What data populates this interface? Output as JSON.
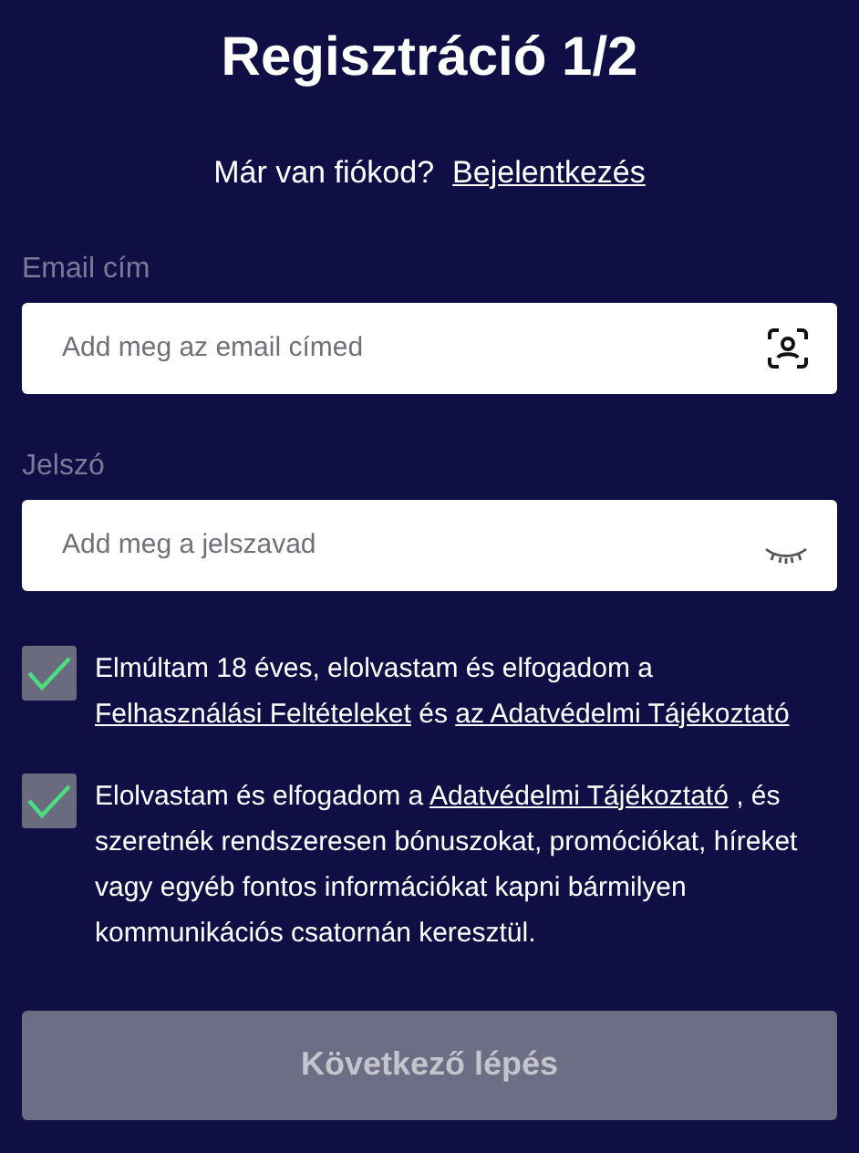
{
  "title": "Regisztráció 1/2",
  "login_prompt": {
    "text": "Már van fiókod?",
    "link": "Bejelentkezés"
  },
  "fields": [
    {
      "label": "Email cím",
      "placeholder": "Add meg az email címed",
      "kind": "email"
    },
    {
      "label": "Jelszó",
      "placeholder": "Add meg a jelszavad",
      "kind": "password"
    }
  ],
  "consents": [
    {
      "checked": true,
      "parts": [
        {
          "text": "Elmúltam 18 éves, elolvastam és elfogadom a ",
          "link": false
        },
        {
          "text": "Felhasználási Feltételeket",
          "link": true
        },
        {
          "text": " és ",
          "link": false
        },
        {
          "text": "az Adatvédelmi Tájékoztató",
          "link": true
        }
      ]
    },
    {
      "checked": true,
      "parts": [
        {
          "text": "Elolvastam és elfogadom a ",
          "link": false
        },
        {
          "text": "Adatvédelmi Tájékoztató",
          "link": true
        },
        {
          "text": " , és szeretnék rendszeresen bónuszokat, promóciókat, híreket vagy egyéb fontos információkat kapni bármilyen kommunikációs csatornán keresztül.",
          "link": false
        }
      ]
    }
  ],
  "next_button": {
    "label": "Következő lépés",
    "disabled": true
  }
}
